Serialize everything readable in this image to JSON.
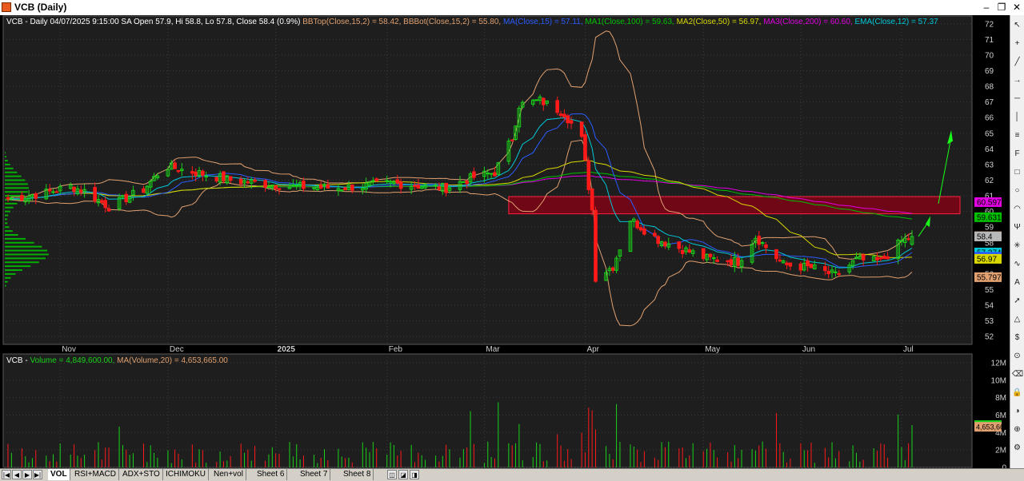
{
  "window": {
    "title": "VCB (Daily)",
    "minimize": "–",
    "restore": "❐",
    "close": "✕"
  },
  "header": {
    "part1": "VCB - Daily 04/07/2025 9:15:00 SA Open 57.9, Hi 58.8, Lo 57.8, Close 58.4 (0.9%) ",
    "bbtop": "BBTop(Close,15,2) = 58.42, ",
    "bbbot": "BBBot(Close,15,2) = 55.80, ",
    "ma": "MA(Close,15) = 57.11, ",
    "ma1": "MA1(Close,100) = 59.63, ",
    "ma2": "MA2(Close,50) = 56.97, ",
    "ma3": "MA3(Close,200) = 60.60, ",
    "ema": "EMA(Close,12) = 57.37"
  },
  "volume_header": {
    "part1": "VCB - ",
    "vol": "Volume = 4,849,600.00, ",
    "ma": "MA(Volume,20) = 4,653,665.00"
  },
  "colors": {
    "up": "#19d219",
    "down": "#ff1a1a",
    "bbands": "#e0a070",
    "ma15": "#2a5cff",
    "ma100": "#00c000",
    "ma50": "#d8d800",
    "ma200": "#e000e0",
    "ema12": "#00c8d8",
    "zone": "#8b0015",
    "zone_border": "#ff2040",
    "arrow": "#19ff19",
    "grid": "#3a3a3a"
  },
  "chart_data": [
    {
      "type": "candlestick",
      "title": "VCB (Daily)",
      "x_labels": [
        "Nov",
        "Dec",
        "2025",
        "Feb",
        "Mar",
        "Apr",
        "May",
        "Jun",
        "Jul"
      ],
      "ylim": [
        51.5,
        72.5
      ],
      "y_ticks": [
        52,
        53,
        54,
        55,
        56,
        57,
        58,
        59,
        60,
        61,
        62,
        63,
        64,
        65,
        66,
        67,
        68,
        69,
        70,
        71,
        72
      ],
      "grid": true,
      "ohlc_keypoints": [
        {
          "d": "2024-10-17",
          "c": 60.8
        },
        {
          "d": "2024-10-28",
          "c": 61.2
        },
        {
          "d": "2024-11-04",
          "c": 61.6
        },
        {
          "d": "2024-11-08",
          "c": 61.3
        },
        {
          "d": "2024-11-15",
          "c": 60.3
        },
        {
          "d": "2024-11-25",
          "c": 61.4
        },
        {
          "d": "2024-12-01",
          "c": 62.9
        },
        {
          "d": "2024-12-10",
          "c": 62.5
        },
        {
          "d": "2024-12-20",
          "c": 62.0
        },
        {
          "d": "2025-01-06",
          "c": 61.6
        },
        {
          "d": "2025-01-20",
          "c": 61.5
        },
        {
          "d": "2025-02-05",
          "c": 61.8
        },
        {
          "d": "2025-02-20",
          "c": 61.5
        },
        {
          "d": "2025-02-28",
          "c": 62.2
        },
        {
          "d": "2025-03-06",
          "c": 62.5
        },
        {
          "d": "2025-03-11",
          "c": 64.7
        },
        {
          "d": "2025-03-13",
          "c": 66.8
        },
        {
          "d": "2025-03-19",
          "c": 67.1
        },
        {
          "d": "2025-03-26",
          "c": 66.3
        },
        {
          "d": "2025-03-31",
          "c": 64.6
        },
        {
          "d": "2025-04-03",
          "c": 60.1
        },
        {
          "d": "2025-04-04",
          "c": 55.8
        },
        {
          "d": "2025-04-09",
          "c": 56.5
        },
        {
          "d": "2025-04-14",
          "c": 59.5
        },
        {
          "d": "2025-04-22",
          "c": 58.2
        },
        {
          "d": "2025-05-06",
          "c": 57.0
        },
        {
          "d": "2025-05-15",
          "c": 56.8
        },
        {
          "d": "2025-05-20",
          "c": 58.4
        },
        {
          "d": "2025-05-28",
          "c": 56.6
        },
        {
          "d": "2025-06-05",
          "c": 56.4
        },
        {
          "d": "2025-06-12",
          "c": 55.9
        },
        {
          "d": "2025-06-18",
          "c": 56.9
        },
        {
          "d": "2025-06-25",
          "c": 56.8
        },
        {
          "d": "2025-07-01",
          "c": 58.1
        },
        {
          "d": "2025-07-04",
          "c": 58.4
        }
      ],
      "last_bar": {
        "date": "04/07/2025",
        "open": 57.9,
        "high": 58.8,
        "low": 57.8,
        "close": 58.4
      },
      "indicators": {
        "BBTop(Close,15,2)": 58.42,
        "BBBot(Close,15,2)": 55.8,
        "MA(Close,15)": 57.11,
        "MA1(Close,100)": 59.63,
        "MA2(Close,50)": 56.97,
        "MA3(Close,200)": 60.6,
        "EMA(Close,12)": 57.37
      },
      "price_badges": [
        {
          "label": "60.5975",
          "value": 60.5975,
          "color": "#e000e0"
        },
        {
          "label": "59.6314",
          "value": 59.6314,
          "color": "#00c000"
        },
        {
          "label": "58.4161",
          "value": 58.4161,
          "color": "#e0a070"
        },
        {
          "label": "58.4",
          "value": 58.4,
          "color": "#b8b8b8"
        },
        {
          "label": "57.3748",
          "value": 57.3748,
          "color": "#00c8d8"
        },
        {
          "label": "57.1067",
          "value": 57.1067,
          "color": "#2a5cff"
        },
        {
          "label": "56.97",
          "value": 56.97,
          "color": "#d8d800"
        },
        {
          "label": "55.7973",
          "value": 55.7973,
          "color": "#e0a070"
        }
      ],
      "resistance_zone": {
        "from_date": "2025-03-10",
        "low": 59.85,
        "high": 60.95
      }
    },
    {
      "type": "bar",
      "title": "VCB - Volume",
      "y_ticks": [
        "0",
        "2M",
        "4M",
        "6M",
        "8M",
        "10M",
        "12M"
      ],
      "y_tick_values": [
        0,
        2,
        4,
        6,
        8,
        10,
        12
      ],
      "ylim": [
        0,
        13
      ],
      "unit": "M",
      "last_volume": 4849600,
      "ma_volume_20": 4653665,
      "badges": [
        {
          "label": "4,849,600",
          "value": 4.8496,
          "color": "#19d219"
        },
        {
          "label": "4,653,665",
          "value": 4.653665,
          "color": "#e0a070"
        }
      ]
    }
  ],
  "toolbar_icons": [
    "cursor-icon",
    "crosshair-icon",
    "line-icon",
    "ray-icon",
    "hline-icon",
    "vline-icon",
    "channel-icon",
    "fib-icon",
    "rectangle-icon",
    "ellipse-icon",
    "arc-icon",
    "pitchfork-icon",
    "gann-icon",
    "cycle-icon",
    "text-icon",
    "arrow-icon",
    "triangle-icon",
    "price-icon",
    "magnet-icon",
    "eraser-icon",
    "lock-icon",
    "hide-icon",
    "zoom-icon",
    "settings-icon"
  ],
  "tabs": [
    "VOL",
    "RSI+MACD",
    "ADX+STO",
    "ICHIMOKU",
    "Nen+vol",
    "Sheet 6",
    "Sheet 7",
    "Sheet 8"
  ],
  "tab_extra": [
    "◫",
    "◪",
    "◨"
  ]
}
